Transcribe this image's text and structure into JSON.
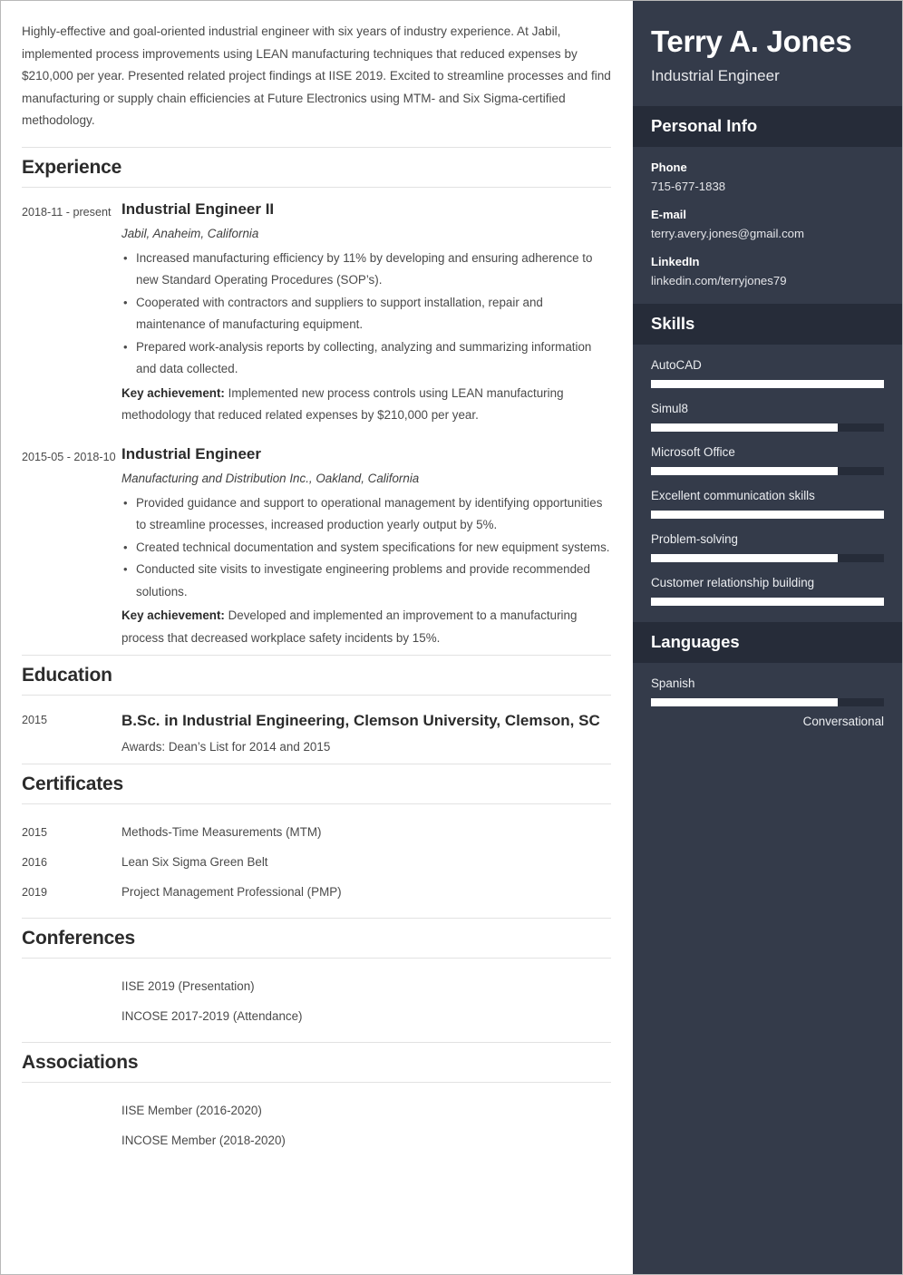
{
  "resume": {
    "summary": "Highly-effective and goal-oriented industrial engineer with six years of industry experience. At Jabil, implemented process improvements using LEAN manufacturing techniques that reduced expenses by $210,000 per year. Presented related project findings at IISE 2019. Excited to streamline processes and find manufacturing or supply chain efficiencies at Future Electronics using MTM- and Six Sigma-certified methodology.",
    "sections": {
      "experience_heading": "Experience",
      "education_heading": "Education",
      "certificates_heading": "Certificates",
      "conferences_heading": "Conferences",
      "associations_heading": "Associations"
    },
    "experience": [
      {
        "dates": "2018-11 - present",
        "title": "Industrial Engineer II",
        "company": "Jabil, Anaheim, California",
        "bullets": [
          "Increased manufacturing efficiency by 11% by developing and ensuring adherence to new Standard Operating Procedures (SOP’s).",
          "Cooperated with contractors and suppliers to support installation, repair and maintenance of manufacturing equipment.",
          "Prepared work-analysis reports by collecting, analyzing and summarizing information and data collected."
        ],
        "key_achievement_label": "Key achievement:",
        "key_achievement": " Implemented new process controls using LEAN manufacturing methodology that reduced related expenses by $210,000 per year."
      },
      {
        "dates": "2015-05 - 2018-10",
        "title": "Industrial Engineer",
        "company": "Manufacturing and Distribution Inc., Oakland, California",
        "bullets": [
          "Provided guidance and support to operational management by identifying opportunities to streamline processes, increased production yearly output by 5%.",
          "Created technical documentation and system specifications for new equipment systems.",
          "Conducted site visits to investigate engineering problems and provide recommended solutions."
        ],
        "key_achievement_label": "Key achievement:",
        "key_achievement": " Developed and implemented an improvement to a manufacturing process that decreased workplace safety incidents by 15%."
      }
    ],
    "education": [
      {
        "dates": "2015",
        "title": "B.Sc. in Industrial Engineering, Clemson University, Clemson, SC",
        "awards": "Awards: Dean’s List for 2014 and 2015"
      }
    ],
    "certificates": [
      {
        "year": "2015",
        "name": "Methods-Time Measurements (MTM)"
      },
      {
        "year": "2016",
        "name": "Lean Six Sigma Green Belt"
      },
      {
        "year": "2019",
        "name": "Project Management Professional (PMP)"
      }
    ],
    "conferences": [
      {
        "year": "",
        "name": "IISE 2019 (Presentation)"
      },
      {
        "year": "",
        "name": "INCOSE 2017-2019 (Attendance)"
      }
    ],
    "associations": [
      {
        "year": "",
        "name": "IISE Member (2016-2020)"
      },
      {
        "year": "",
        "name": "INCOSE Member (2018-2020)"
      }
    ]
  },
  "sidebar": {
    "name": "Terry A. Jones",
    "role": "Industrial Engineer",
    "personal_info_heading": "Personal Info",
    "personal_info": [
      {
        "label": "Phone",
        "value": "715-677-1838"
      },
      {
        "label": "E-mail",
        "value": "terry.avery.jones@gmail.com"
      },
      {
        "label": "LinkedIn",
        "value": "linkedin.com/terryjones79"
      }
    ],
    "skills_heading": "Skills",
    "skills": [
      {
        "name": "AutoCAD",
        "level": 100
      },
      {
        "name": "Simul8",
        "level": 80
      },
      {
        "name": "Microsoft Office",
        "level": 80
      },
      {
        "name": "Excellent communication skills",
        "level": 100
      },
      {
        "name": "Problem-solving",
        "level": 80
      },
      {
        "name": "Customer relationship building",
        "level": 100
      }
    ],
    "languages_heading": "Languages",
    "languages": [
      {
        "name": "Spanish",
        "level": 80,
        "level_label": "Conversational"
      }
    ]
  },
  "colors": {
    "sidebar_bg": "#343b4a",
    "sidebar_header_bg": "#262c39",
    "bar_fill": "#ffffff",
    "text_dark": "#2b2b2b",
    "text_body": "#4a4a4a",
    "divider": "#e2e2e2"
  }
}
